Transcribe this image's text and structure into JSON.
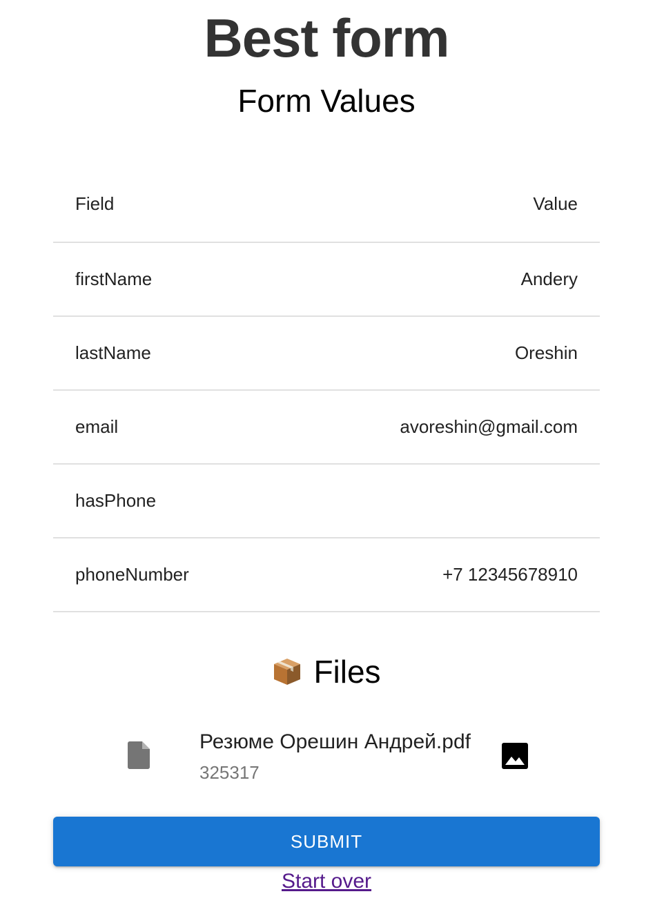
{
  "header": {
    "app_title": "Best form",
    "section_title": "Form Values"
  },
  "table": {
    "columns": [
      "Field",
      "Value"
    ],
    "rows": [
      {
        "field": "firstName",
        "value": "Andery"
      },
      {
        "field": "lastName",
        "value": "Oreshin"
      },
      {
        "field": "email",
        "value": "avoreshin@gmail.com"
      },
      {
        "field": "hasPhone",
        "value": ""
      },
      {
        "field": "phoneNumber",
        "value": "+7 12345678910"
      }
    ]
  },
  "files": {
    "title": "Files",
    "icon": "package-icon",
    "items": [
      {
        "name": "Резюме Орешин Андрей.pdf",
        "size": "325317",
        "icon": "file-icon",
        "action_icon": "image-icon"
      }
    ]
  },
  "actions": {
    "submit_label": "Submit",
    "start_over_label": "Start over"
  },
  "colors": {
    "primary": "#1976d2",
    "link_visited": "#551a8b",
    "title": "#333333",
    "divider": "#e0e0e0"
  }
}
